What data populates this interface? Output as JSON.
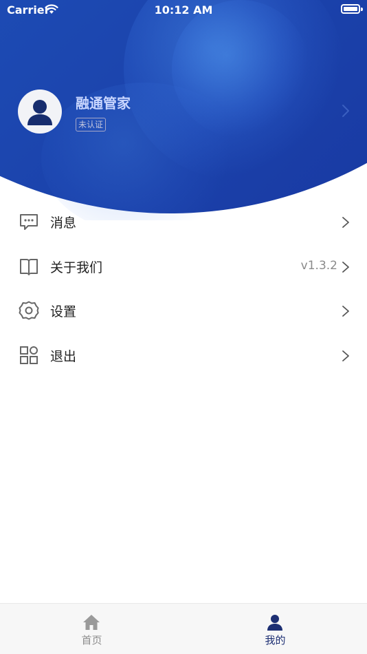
{
  "status_bar": {
    "carrier": "Carrier",
    "time": "10:12 AM"
  },
  "profile": {
    "name": "融通管家",
    "badge": "未认证"
  },
  "menu": [
    {
      "label": "消息",
      "icon": "message-icon",
      "value": ""
    },
    {
      "label": "关于我们",
      "icon": "book-icon",
      "value": "v1.3.2"
    },
    {
      "label": "设置",
      "icon": "gear-icon",
      "value": ""
    },
    {
      "label": "退出",
      "icon": "grid-icon",
      "value": ""
    }
  ],
  "tabbar": {
    "tabs": [
      {
        "label": "首页",
        "icon": "home-icon",
        "active": false
      },
      {
        "label": "我的",
        "icon": "person-icon",
        "active": true
      }
    ]
  },
  "colors": {
    "header_gradient": [
      "#2a74d8",
      "#1e4fb8",
      "#17339c"
    ],
    "active_tab": "#1d2f73",
    "inactive_tab": "#8d8d8d"
  }
}
